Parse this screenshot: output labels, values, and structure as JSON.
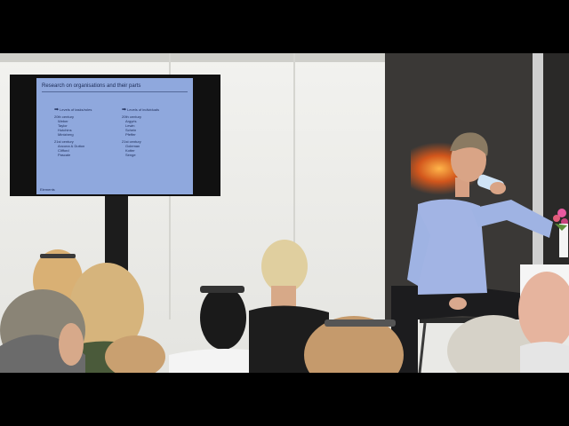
{
  "slide": {
    "title": "Research on organisations and their parts",
    "left_column": {
      "heading": "Levels of tasks/roles",
      "group1_label": "20th century",
      "group1_items": [
        "Weber",
        "Taylor",
        "Hutchins",
        "Mintzberg"
      ],
      "group2_label": "21st century",
      "group2_items": [
        "Ancona & Dutton",
        "Clifford",
        "Pascale"
      ]
    },
    "right_column": {
      "heading": "Levels of individuals",
      "group1_label": "20th century",
      "group1_items": [
        "Argyris",
        "Lewin",
        "Schein",
        "Pfeffer"
      ],
      "group2_label": "21st century",
      "group2_items": [
        "Goleman",
        "Kotter",
        "Senge"
      ]
    },
    "footer": "Elements"
  },
  "colors": {
    "slide_background": "#8fa8dd",
    "backdrop": "#3a3836",
    "shirt": "#9fb3e3"
  }
}
